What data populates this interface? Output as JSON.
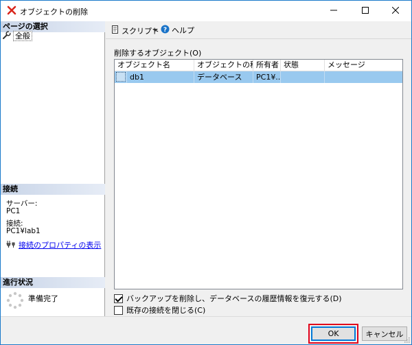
{
  "window": {
    "title": "オブジェクトの削除",
    "accent_color": "#1979ca"
  },
  "sidebar": {
    "page_select_header": "ページの選択",
    "items": [
      {
        "label": "全般",
        "icon": "wrench-icon"
      }
    ],
    "connection_header": "接続",
    "server_label": "サーバー:",
    "server_value": "PC1",
    "connection_label": "接続:",
    "connection_value": "PC1¥lab1",
    "view_connection_properties": "接続のプロパティの表示",
    "progress_header": "進行状況",
    "progress_status": "準備完了"
  },
  "toolbar": {
    "script_label": "スクリプト",
    "help_label": "ヘルプ"
  },
  "main": {
    "list_label": "削除するオブジェクト(O)",
    "columns": [
      "オブジェクト名",
      "オブジェクトの種類",
      "所有者",
      "状態",
      "メッセージ"
    ],
    "rows": [
      {
        "name": "db1",
        "type": "データベース",
        "owner": "PC1¥...",
        "status": "",
        "message": ""
      }
    ],
    "checkbox_backup_history": {
      "label": "バックアップを削除し、データベースの履歴情報を復元する(D)",
      "checked": true
    },
    "checkbox_close_connections": {
      "label": "既存の接続を閉じる(C)",
      "checked": false
    }
  },
  "buttons": {
    "ok": "OK",
    "cancel": "キャンセル"
  }
}
